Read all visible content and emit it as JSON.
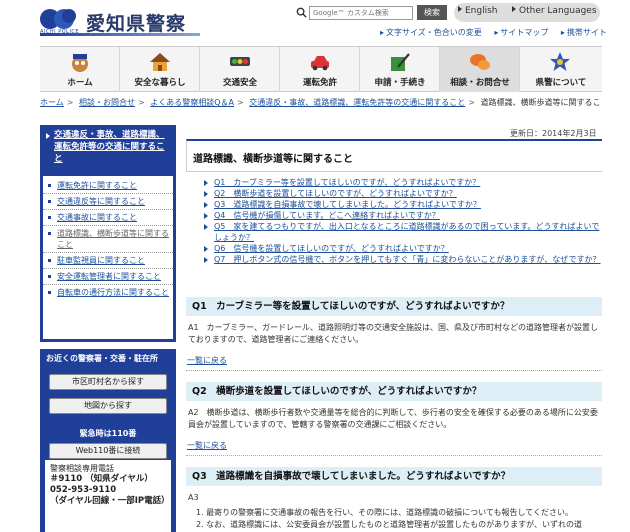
{
  "header": {
    "site_title": "愛知県警察",
    "logo_caption": "AICHI POLICE",
    "search_placeholder": "Google™ カスタム検索",
    "search_button": "検索",
    "lang_english": "English",
    "lang_other": "Other Languages",
    "utility": [
      "文字サイズ・色合いの変更",
      "サイトマップ",
      "携帯サイト"
    ]
  },
  "nav": [
    {
      "label": "ホーム",
      "icon": "police-mascot-icon"
    },
    {
      "label": "安全な暮らし",
      "icon": "house-icon"
    },
    {
      "label": "交通安全",
      "icon": "traffic-light-icon"
    },
    {
      "label": "運転免許",
      "icon": "car-icon"
    },
    {
      "label": "申請・手続き",
      "icon": "pen-document-icon"
    },
    {
      "label": "相談・お問合せ",
      "icon": "speech-bubble-icon"
    },
    {
      "label": "県警について",
      "icon": "emblem-icon"
    }
  ],
  "nav_active_index": 5,
  "breadcrumb": {
    "links": [
      "ホーム",
      "相談・お問合せ",
      "よくある警察相談Q＆A",
      "交通違反・事故、道路標識、運転免許等の交通に関すること"
    ],
    "current": "道路標識、横断歩道等に関すること"
  },
  "sidebar": {
    "heading": "交通違反・事故、道路標識、運転免許等の交通に関すること",
    "items": [
      "運転免許に関すること",
      "交通違反等に関すること",
      "交通事故に関すること",
      "道路標識、横断歩道等に関すること",
      "駐車監視員に関すること",
      "安全運転管理者に関すること",
      "自転車の通行方法に関すること"
    ],
    "current_index": 3,
    "police_title": "お近くの警察署・交番・駐在所",
    "btn_city": "市区町村名から探す",
    "btn_map": "地図から探す",
    "emergency": "緊急時は110番",
    "btn_web110": "Web110番に接続",
    "tel_label": "警察相談専用電話",
    "tel_short": "＃9110 （知県ダイヤル）",
    "tel_number": "052-953-9110",
    "tel_note": "（ダイヤル回線・一部IP電話）"
  },
  "main": {
    "updated": "更新日：2014年2月3日",
    "title": "道路標識、横断歩道等に関すること",
    "questions": [
      "Q1　カーブミラー等を設置してほしいのですが、どうすればよいですか？",
      "Q2　横断歩道を設置してほしいのですが、どうすればよいですか？",
      "Q3　道路標識を自損事故で壊してしまいました。どうすればよいですか？",
      "Q4　信号機が損傷しています。どこへ連絡すればよいですか？",
      "Q5　家を建てるつもりですが、出入口となるところに道路標識があるので困っています。どうすればよいでしょうか？",
      "Q6　信号機を設置してほしいのですが、どうすればよいですか？",
      "Q7　押しボタン式の信号機で、ボタンを押してもすぐ「青」に変わらないことがありますが、なぜですか？"
    ],
    "sections": [
      {
        "heading": "Q1　カーブミラー等を設置してほしいのですが、どうすればよいですか？",
        "answer": "A1　カーブミラー、ガードレール、道路照明灯等の交通安全施設は、国、県及び市町村などの道路管理者が設置しておりますので、道路管理者にご連絡ください。"
      },
      {
        "heading": "Q2　横断歩道を設置してほしいのですが、どうすればよいですか？",
        "answer": "A2　横断歩道は、横断歩行者数や交通量等を総合的に判断して、歩行者の安全を確保する必要のある場所に公安委員会が設置していますので、管轄する警察署の交通課にご相談ください。"
      },
      {
        "heading": "Q3　道路標識を自損事故で壊してしまいました。どうすればよいですか？",
        "answer_label": "A3",
        "answer_items": [
          "1. 最寄りの警察署に交通事故の報告を行い、その際には、道路標識の破損についても報告してください。",
          "2. なお、道路標識には、公安委員会が設置したものと道路管理者が設置したものがありますが、いずれの道"
        ]
      }
    ],
    "back_link": "一覧に戻る"
  }
}
